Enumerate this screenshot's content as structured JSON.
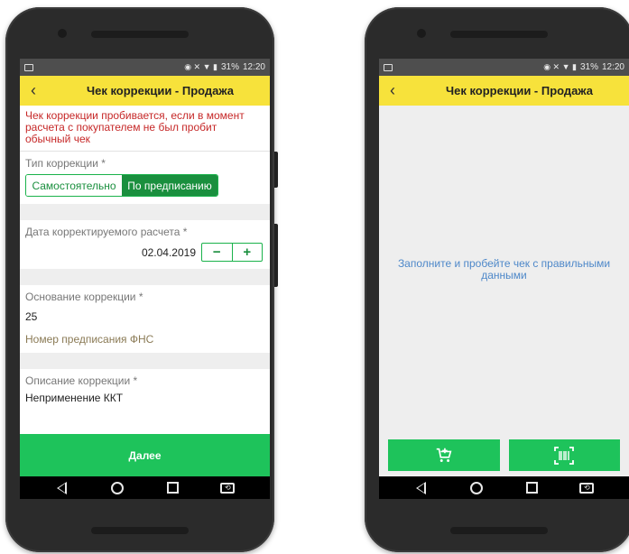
{
  "left": {
    "status": {
      "battery": "31%",
      "time": "12:20"
    },
    "appbar": {
      "title": "Чек коррекции - Продажа"
    },
    "warning": "Чек коррекции пробивается, если в момент расчета с покупателем не был пробит обычный чек",
    "correction_type": {
      "label": "Тип коррекции *",
      "options": [
        "Самостоятельно",
        "По предписанию"
      ],
      "selected": "По предписанию"
    },
    "date": {
      "label": "Дата корректируемого расчета *",
      "value": "02.04.2019",
      "minus": "−",
      "plus": "+"
    },
    "basis": {
      "label": "Основание коррекции *",
      "value": "25",
      "sub_label": "Номер предписания ФНС"
    },
    "description": {
      "label": "Описание коррекции *",
      "value": "Неприменение ККТ"
    },
    "primary_button": "Далее"
  },
  "right": {
    "status": {
      "battery": "31%",
      "time": "12:20"
    },
    "appbar": {
      "title": "Чек коррекции - Продажа"
    },
    "empty_message": "Заполните и пробейте чек с правильными данными",
    "actions": [
      "add-to-cart-icon",
      "barcode-scan-icon"
    ]
  },
  "colors": {
    "appbar": "#f7e23b",
    "primary": "#1ec35b",
    "accent": "#1a8f3e",
    "warning": "#c62828",
    "link": "#4e88c9"
  }
}
